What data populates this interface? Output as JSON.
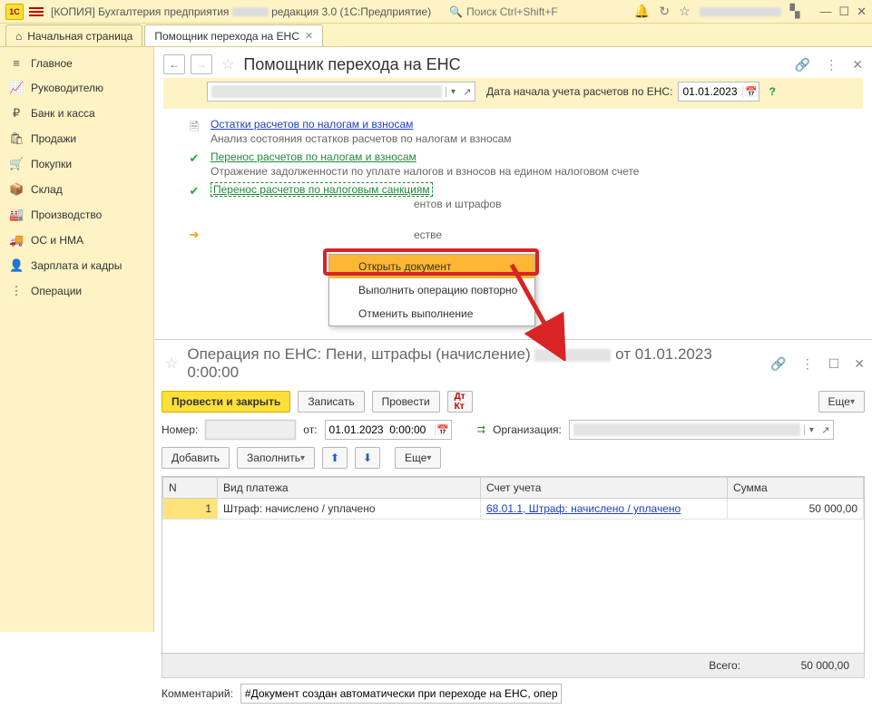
{
  "titlebar": {
    "app_title_prefix": "[КОПИЯ] Бухгалтерия предприятия",
    "app_title_suffix": "редакция 3.0  (1С:Предприятие)",
    "search_placeholder": "Поиск Ctrl+Shift+F"
  },
  "tabs": {
    "home": "Начальная страница",
    "active": "Помощник перехода на ЕНС"
  },
  "sidebar": {
    "items": [
      {
        "icon": "≡",
        "label": "Главное"
      },
      {
        "icon": "📈",
        "label": "Руководителю"
      },
      {
        "icon": "₽",
        "label": "Банк и касса"
      },
      {
        "icon": "🛍",
        "label": "Продажи"
      },
      {
        "icon": "🛒",
        "label": "Покупки"
      },
      {
        "icon": "📦",
        "label": "Склад"
      },
      {
        "icon": "🏭",
        "label": "Производство"
      },
      {
        "icon": "🚚",
        "label": "ОС и НМА"
      },
      {
        "icon": "👤",
        "label": "Зарплата и кадры"
      },
      {
        "icon": "⋮",
        "label": "Операции"
      }
    ]
  },
  "assistant": {
    "title": "Помощник перехода на ЕНС",
    "date_label": "Дата начала учета расчетов по ЕНС:",
    "date_value": "01.01.2023",
    "steps": [
      {
        "ico": "doc",
        "link": "Остатки расчетов по налогам и взносам",
        "link_class": "step-link",
        "desc": "Анализ состояния остатков расчетов по налогам и взносам"
      },
      {
        "ico": "ok",
        "link": "Перенос расчетов по налогам и взносам",
        "link_class": "step-link green",
        "desc": "Отражение задолженности по уплате налогов и взносов на едином налоговом счете"
      },
      {
        "ico": "ok",
        "link": "Перенос расчетов по налоговым санкциям",
        "link_class": "step-link greenbox",
        "desc_overlay": "ентов и штрафов"
      },
      {
        "ico": "arrow",
        "desc_overlay": "естве"
      }
    ]
  },
  "context_menu": {
    "items": [
      "Открыть документ",
      "Выполнить операцию повторно",
      "Отменить выполнение"
    ]
  },
  "doc": {
    "title_prefix": "Операция по ЕНС: Пени, штрафы (начисление)",
    "title_suffix": "от 01.01.2023 0:00:00",
    "buttons": {
      "post_close": "Провести и закрыть",
      "write": "Записать",
      "post": "Провести",
      "more": "Еще"
    },
    "fields": {
      "number_label": "Номер:",
      "date_label": "от:",
      "date_value": "01.01.2023  0:00:00",
      "org_label": "Организация:"
    },
    "toolbar2": {
      "add": "Добавить",
      "fill": "Заполнить"
    },
    "columns": {
      "n": "N",
      "type": "Вид платежа",
      "account": "Счет учета",
      "sum": "Сумма"
    },
    "rows": [
      {
        "n": "1",
        "type": "Штраф: начислено / уплачено",
        "account": "68.01.1, Штраф: начислено / уплачено",
        "sum": "50 000,00"
      }
    ],
    "totals": {
      "label": "Всего:",
      "value": "50 000,00"
    },
    "comment_label": "Комментарий:",
    "comment_value": "#Документ создан автоматически при переходе на ЕНС, операция"
  }
}
